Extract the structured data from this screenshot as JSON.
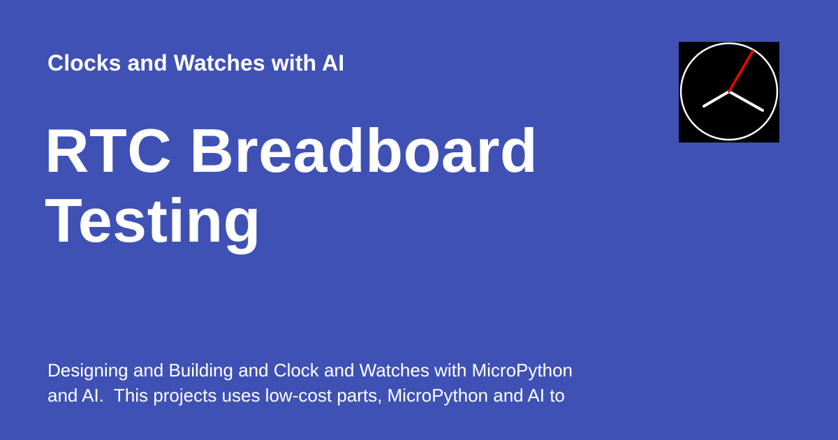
{
  "header": {
    "site_name": "Clocks and Watches with AI"
  },
  "main": {
    "title_line_1": "RTC Breadboard",
    "title_line_2": "Testing",
    "description": "Designing and Building and Clock and Watches with MicroPython\nand AI.  This projects uses low-cost parts, MicroPython and AI to"
  },
  "logo": {
    "icon": "analog-clock-icon",
    "background": "#000000",
    "face_color": "#ffffff",
    "second_hand_color": "#ff0000",
    "hand_color": "#ffffff"
  },
  "theme": {
    "background": "#3f51b5",
    "text": "#ffffff"
  }
}
